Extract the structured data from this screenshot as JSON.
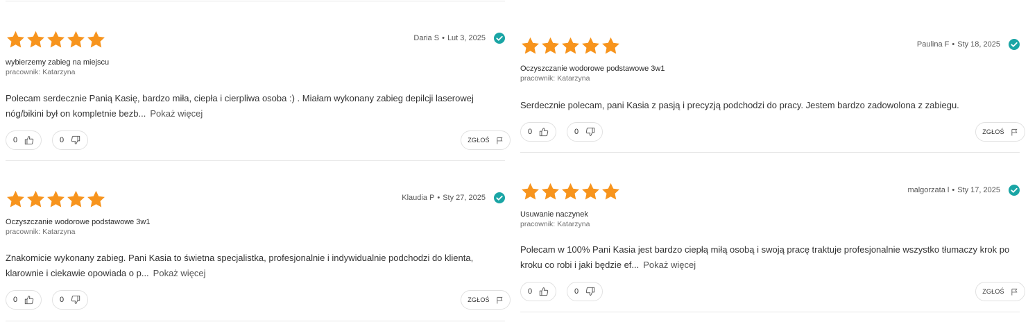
{
  "ui": {
    "show_more": "Pokaż więcej",
    "report": "ZGŁOŚ",
    "employee_prefix": "pracownik:",
    "date_separator": "•"
  },
  "colors": {
    "star": "#F7941D",
    "verified": "#1AA5A5"
  },
  "reviews": [
    {
      "rating": 5,
      "author": "Daria S",
      "date": "Lut 3, 2025",
      "verified": true,
      "service": "wybierzemy zabieg na miejscu",
      "employee": "Katarzyna",
      "text": "Polecam serdecznie Panią Kasię, bardzo miła, ciepła i cierpliwa osoba :) . Miałam wykonany zabieg depilcji laserowej nóg/bikini był on kompletnie bezb...",
      "likes": "0",
      "dislikes": "0"
    },
    {
      "rating": 5,
      "author": "Paulina F",
      "date": "Sty 18, 2025",
      "verified": true,
      "service": "Oczyszczanie wodorowe podstawowe 3w1",
      "employee": "Katarzyna",
      "text": "Serdecznie polecam, pani Kasia z pasją i precyzją podchodzi do pracy. Jestem bardzo zadowolona z zabiegu.",
      "likes": "0",
      "dislikes": "0"
    },
    {
      "rating": 5,
      "author": "Klaudia P",
      "date": "Sty 27, 2025",
      "verified": true,
      "service": "Oczyszczanie wodorowe podstawowe 3w1",
      "employee": "Katarzyna",
      "text": "Znakomicie wykonany zabieg. Pani Kasia to świetna specjalistka, profesjonalnie i indywidualnie podchodzi do klienta, klarownie i ciekawie opowiada o p...",
      "likes": "0",
      "dislikes": "0"
    },
    {
      "rating": 5,
      "author": "malgorzata l",
      "date": "Sty 17, 2025",
      "verified": true,
      "service": "Usuwanie naczynek",
      "employee": "Katarzyna",
      "text": "Polecam w 100% Pani Kasia jest bardzo ciepłą miłą osobą i swoją pracę traktuje profesjonalnie wszystko tłumaczy krok po kroku co robi i jaki będzie ef...",
      "likes": "0",
      "dislikes": "0"
    }
  ]
}
